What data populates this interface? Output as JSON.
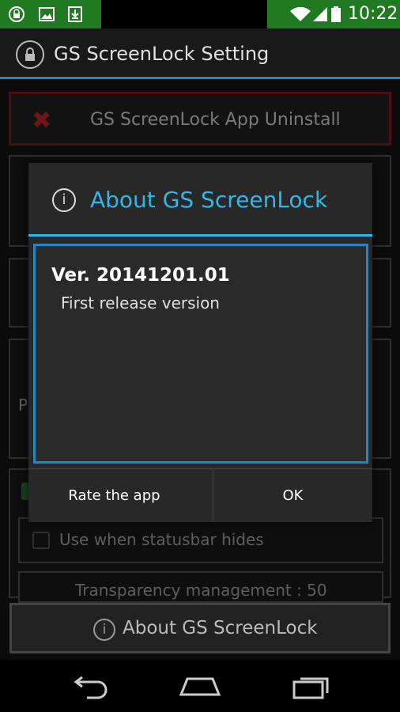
{
  "status_bar": {
    "time": "10:22",
    "icons": [
      "lock-icon",
      "image-icon",
      "download-icon",
      "wifi-icon",
      "signal-icon",
      "battery-icon"
    ]
  },
  "app_bar": {
    "title": "GS ScreenLock Setting"
  },
  "background": {
    "uninstall_label": "GS ScreenLock App Uninstall",
    "statusbar_hides_label": "Use when statusbar hides",
    "transparency_label": "Transparency management : 50",
    "partial_letter": "P",
    "about_label": "About GS ScreenLock"
  },
  "dialog": {
    "title": "About GS ScreenLock",
    "version": "Ver. 20141201.01",
    "description": "First release version",
    "rate_label": "Rate the app",
    "ok_label": "OK"
  },
  "colors": {
    "accent": "#33b5e5",
    "status_green": "#1f7a22",
    "uninstall_red": "#c62828"
  }
}
